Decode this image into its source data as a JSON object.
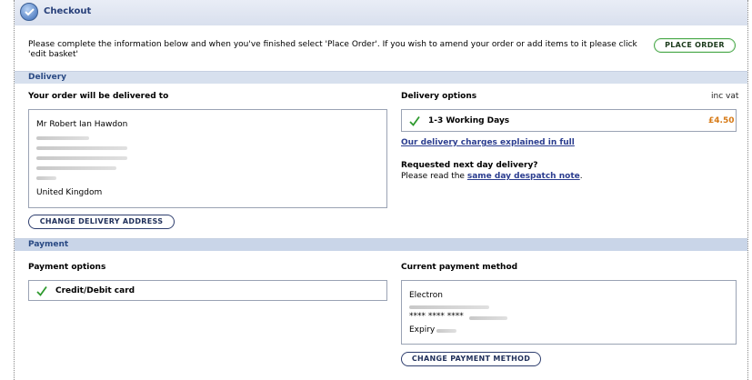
{
  "header": {
    "title": "Checkout",
    "icon": "checkout-shield-icon"
  },
  "intro": {
    "text": "Please complete the information below and when you've finished select 'Place Order'. If you wish to amend your order or add items to it please click 'edit basket'",
    "place_order_label": "PLACE ORDER"
  },
  "delivery": {
    "section_title": "Delivery",
    "address_heading": "Your order will be delivered to",
    "address": {
      "name": "Mr Robert Ian Hawdon",
      "country": "United Kingdom"
    },
    "change_address_label": "CHANGE DELIVERY ADDRESS",
    "options_heading": "Delivery options",
    "inc_vat": "inc vat",
    "option": {
      "label": "1-3 Working Days",
      "price": "£4.50",
      "selected": true
    },
    "charges_link": "Our delivery charges explained in full",
    "next_day_question": "Requested next day delivery?",
    "next_day_prefix": "Please read the",
    "next_day_link": "same day despatch note",
    "next_day_suffix": "."
  },
  "payment": {
    "section_title": "Payment",
    "options_heading": "Payment options",
    "option_label": "Credit/Debit card",
    "current_heading": "Current payment method",
    "card_type": "Electron",
    "card_number": "**** **** ****",
    "expiry_label": "Expiry",
    "change_method_label": "CHANGE PAYMENT METHOD"
  },
  "colors": {
    "accent_orange": "#d77a16",
    "link_blue": "#2b3d8f",
    "section_bar": "#d7e0ee",
    "check_green": "#2e9a2e"
  }
}
